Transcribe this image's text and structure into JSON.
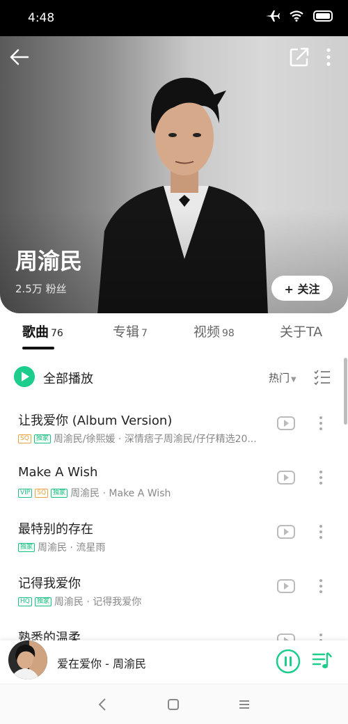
{
  "status": {
    "time": "4:48"
  },
  "artist": {
    "name": "周渝民",
    "fans": "2.5万 粉丝",
    "follow_label": "+ 关注"
  },
  "tabs": [
    {
      "label": "歌曲",
      "count": "76"
    },
    {
      "label": "专辑",
      "count": "7"
    },
    {
      "label": "视频",
      "count": "98"
    },
    {
      "label": "关于TA",
      "count": ""
    }
  ],
  "play_all": {
    "label": "全部播放",
    "sort": "热门"
  },
  "songs": [
    {
      "title": "让我爱你 (Album Version)",
      "tags": [
        "SQ",
        "独家"
      ],
      "meta": "周渝民/徐熙媛 · 深情痞子周渝民/仔仔精选20..."
    },
    {
      "title": "Make A Wish",
      "tags": [
        "VIP",
        "SQ",
        "独家"
      ],
      "meta": "周渝民 · Make A Wish"
    },
    {
      "title": "最特别的存在",
      "tags": [
        "独家"
      ],
      "meta": "周渝民 · 流星雨"
    },
    {
      "title": "记得我爱你",
      "tags": [
        "HQ",
        "独家"
      ],
      "meta": "周渝民 · 记得我爱你"
    },
    {
      "title": "熟悉的温柔",
      "tags": [],
      "meta": ""
    }
  ],
  "player": {
    "now_playing": "爱在爱你 - 周渝民"
  },
  "colors": {
    "accent": "#1dcd8c",
    "tag_gold": "#e6a23c"
  },
  "icons": [
    "back-arrow-icon",
    "share-icon",
    "more-vertical-icon",
    "play-circle-icon",
    "caret-down-icon",
    "multi-select-icon",
    "mv-play-icon",
    "pause-icon",
    "playlist-icon"
  ]
}
